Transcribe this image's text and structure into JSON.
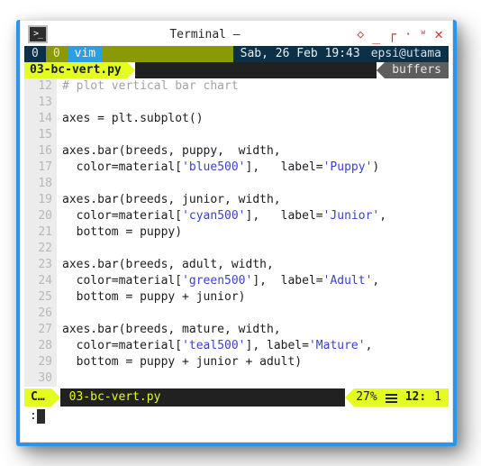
{
  "window": {
    "title": "Terminal –",
    "app_icon": "terminal-prompt-icon",
    "border_color": "#2b95ec",
    "buttons": [
      {
        "name": "shade-icon",
        "glyph": "◇"
      },
      {
        "name": "minimize-icon",
        "glyph": "_"
      },
      {
        "name": "maximize-icon",
        "glyph": "┐"
      },
      {
        "name": "dot-icon",
        "glyph": "·"
      },
      {
        "name": "rollup-icon",
        "glyph": "ᵂ"
      },
      {
        "name": "close-icon",
        "glyph": "✕"
      }
    ]
  },
  "tmux": {
    "session_index": "0",
    "window_index": "0",
    "window_name": "vim",
    "datetime": "Sab, 26 Feb 19:43",
    "user_host": "epsi@utama",
    "file_tab": "03-bc-vert.py",
    "right_label": "buffers",
    "colors": {
      "navy": "#0d3049",
      "olive": "#8a9a07",
      "blue": "#2d9fe0",
      "yellow": "#e4fc20",
      "dark": "#212121",
      "gray": "#5e5e5e"
    }
  },
  "editor": {
    "lines": [
      {
        "num": "12",
        "tokens": [
          {
            "t": "# plot vertical bar chart",
            "c": "cmt"
          }
        ]
      },
      {
        "num": "13",
        "tokens": []
      },
      {
        "num": "14",
        "tokens": [
          {
            "t": "axes = plt.subplot()",
            "c": "pun"
          }
        ]
      },
      {
        "num": "15",
        "tokens": []
      },
      {
        "num": "16",
        "tokens": [
          {
            "t": "axes.bar(breeds, puppy,  width,",
            "c": "pun"
          }
        ]
      },
      {
        "num": "17",
        "tokens": [
          {
            "t": "  color=material[",
            "c": "pun"
          },
          {
            "t": "'blue500'",
            "c": "str"
          },
          {
            "t": "],   label=",
            "c": "pun"
          },
          {
            "t": "'Puppy'",
            "c": "str"
          },
          {
            "t": ")",
            "c": "pun"
          }
        ]
      },
      {
        "num": "18",
        "tokens": []
      },
      {
        "num": "19",
        "tokens": [
          {
            "t": "axes.bar(breeds, junior, width,",
            "c": "pun"
          }
        ]
      },
      {
        "num": "20",
        "tokens": [
          {
            "t": "  color=material[",
            "c": "pun"
          },
          {
            "t": "'cyan500'",
            "c": "str"
          },
          {
            "t": "],   label=",
            "c": "pun"
          },
          {
            "t": "'Junior'",
            "c": "str"
          },
          {
            "t": ",",
            "c": "pun"
          }
        ]
      },
      {
        "num": "21",
        "tokens": [
          {
            "t": "  bottom = puppy)",
            "c": "pun"
          }
        ]
      },
      {
        "num": "22",
        "tokens": []
      },
      {
        "num": "23",
        "tokens": [
          {
            "t": "axes.bar(breeds, adult, width,",
            "c": "pun"
          }
        ]
      },
      {
        "num": "24",
        "tokens": [
          {
            "t": "  color=material[",
            "c": "pun"
          },
          {
            "t": "'green500'",
            "c": "str"
          },
          {
            "t": "],  label=",
            "c": "pun"
          },
          {
            "t": "'Adult'",
            "c": "str"
          },
          {
            "t": ",",
            "c": "pun"
          }
        ]
      },
      {
        "num": "25",
        "tokens": [
          {
            "t": "  bottom = puppy + junior)",
            "c": "pun"
          }
        ]
      },
      {
        "num": "26",
        "tokens": []
      },
      {
        "num": "27",
        "tokens": [
          {
            "t": "axes.bar(breeds, mature, width,",
            "c": "pun"
          }
        ]
      },
      {
        "num": "28",
        "tokens": [
          {
            "t": "  color=material[",
            "c": "pun"
          },
          {
            "t": "'teal500'",
            "c": "str"
          },
          {
            "t": "], label=",
            "c": "pun"
          },
          {
            "t": "'Mature'",
            "c": "str"
          },
          {
            "t": ",",
            "c": "pun"
          }
        ]
      },
      {
        "num": "29",
        "tokens": [
          {
            "t": "  bottom = puppy + junior + adult)",
            "c": "pun"
          }
        ]
      },
      {
        "num": "30",
        "tokens": []
      }
    ]
  },
  "vim_status": {
    "mode": "C…",
    "filename": "03-bc-vert.py",
    "percent": "27%",
    "lines_icon": "lines-icon",
    "line": "12:",
    "column": "1"
  },
  "command_line": {
    "prompt": ":",
    "cursor": "block-cursor"
  }
}
